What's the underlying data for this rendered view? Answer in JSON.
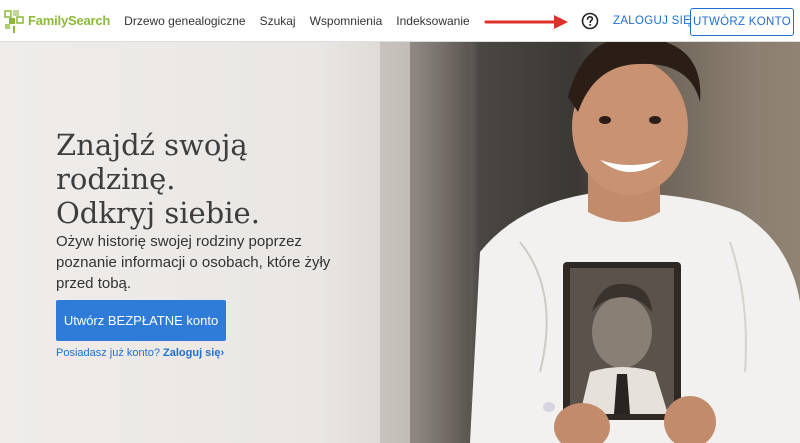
{
  "header": {
    "logo_text": "FamilySearch",
    "nav": [
      {
        "label": "Drzewo genealogiczne"
      },
      {
        "label": "Szukaj"
      },
      {
        "label": "Wspomnienia"
      },
      {
        "label": "Indeksowanie"
      }
    ],
    "signin_label": "ZALOGUJ SIĘ",
    "create_account_label": "UTWÓRZ KONTO",
    "icons": {
      "help": "help-circle-icon",
      "arrow": "arrow-right-icon"
    }
  },
  "hero": {
    "title_lines": [
      "Znajdź swoją",
      "rodzinę.",
      "Odkryj siebie."
    ],
    "subtitle": "Ożyw historię swojej rodziny poprzez poznanie informacji o osobach, które żyły przed tobą.",
    "cta_label": "Utwórz BEZPŁATNE konto",
    "already_text": "Posiadasz już konto?",
    "already_link": "Zaloguj się",
    "already_arrow": "›"
  },
  "colors": {
    "brand_green": "#8cb83c",
    "link_blue": "#1f6fcf",
    "cta_blue": "#2f7bd8",
    "arrow_red": "#e0302a"
  }
}
